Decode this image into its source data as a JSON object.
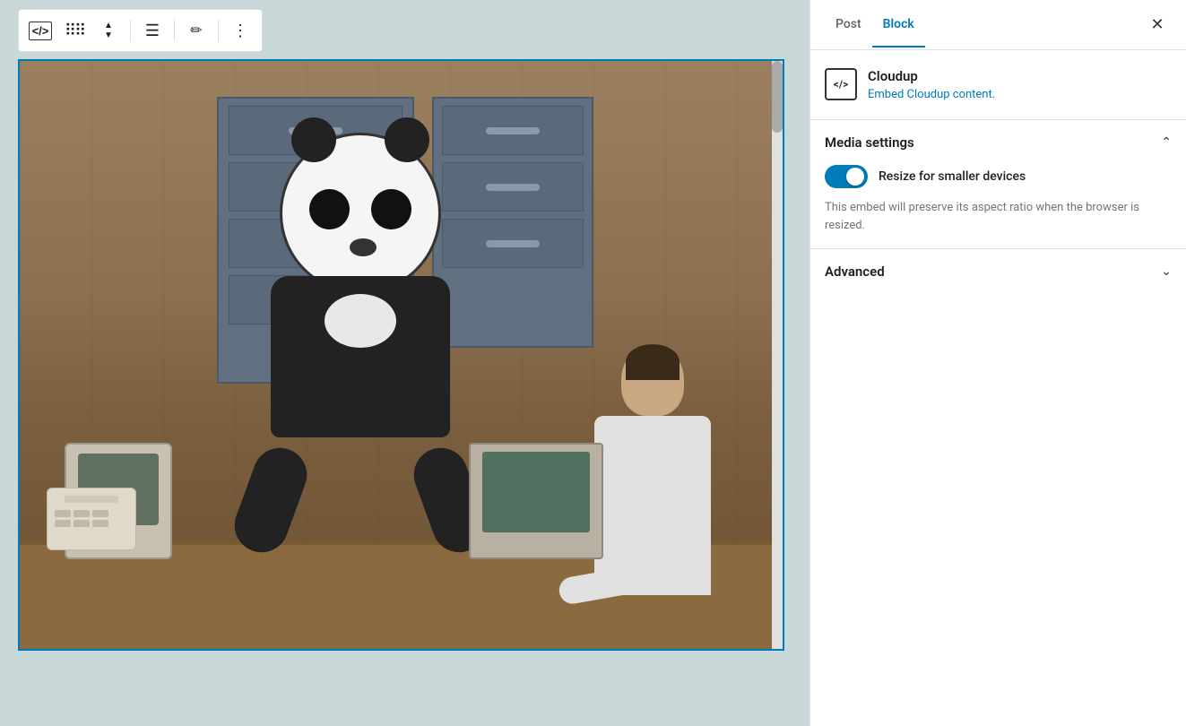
{
  "toolbar": {
    "embed_icon": "</>",
    "drag_icon": "⠿",
    "move_icon": "↕",
    "align_icon": "≡",
    "pen_icon": "✏",
    "more_icon": "⋮"
  },
  "panel": {
    "post_tab": "Post",
    "block_tab": "Block",
    "close_icon": "✕",
    "cloudup": {
      "title": "Cloudup",
      "description": "Embed Cloudup content.",
      "icon": "</>"
    },
    "media_settings": {
      "title": "Media settings",
      "toggle_label": "Resize for smaller devices",
      "toggle_description": "This embed will preserve its aspect ratio when the browser is resized.",
      "toggle_active": true
    },
    "advanced": {
      "title": "Advanced"
    }
  }
}
